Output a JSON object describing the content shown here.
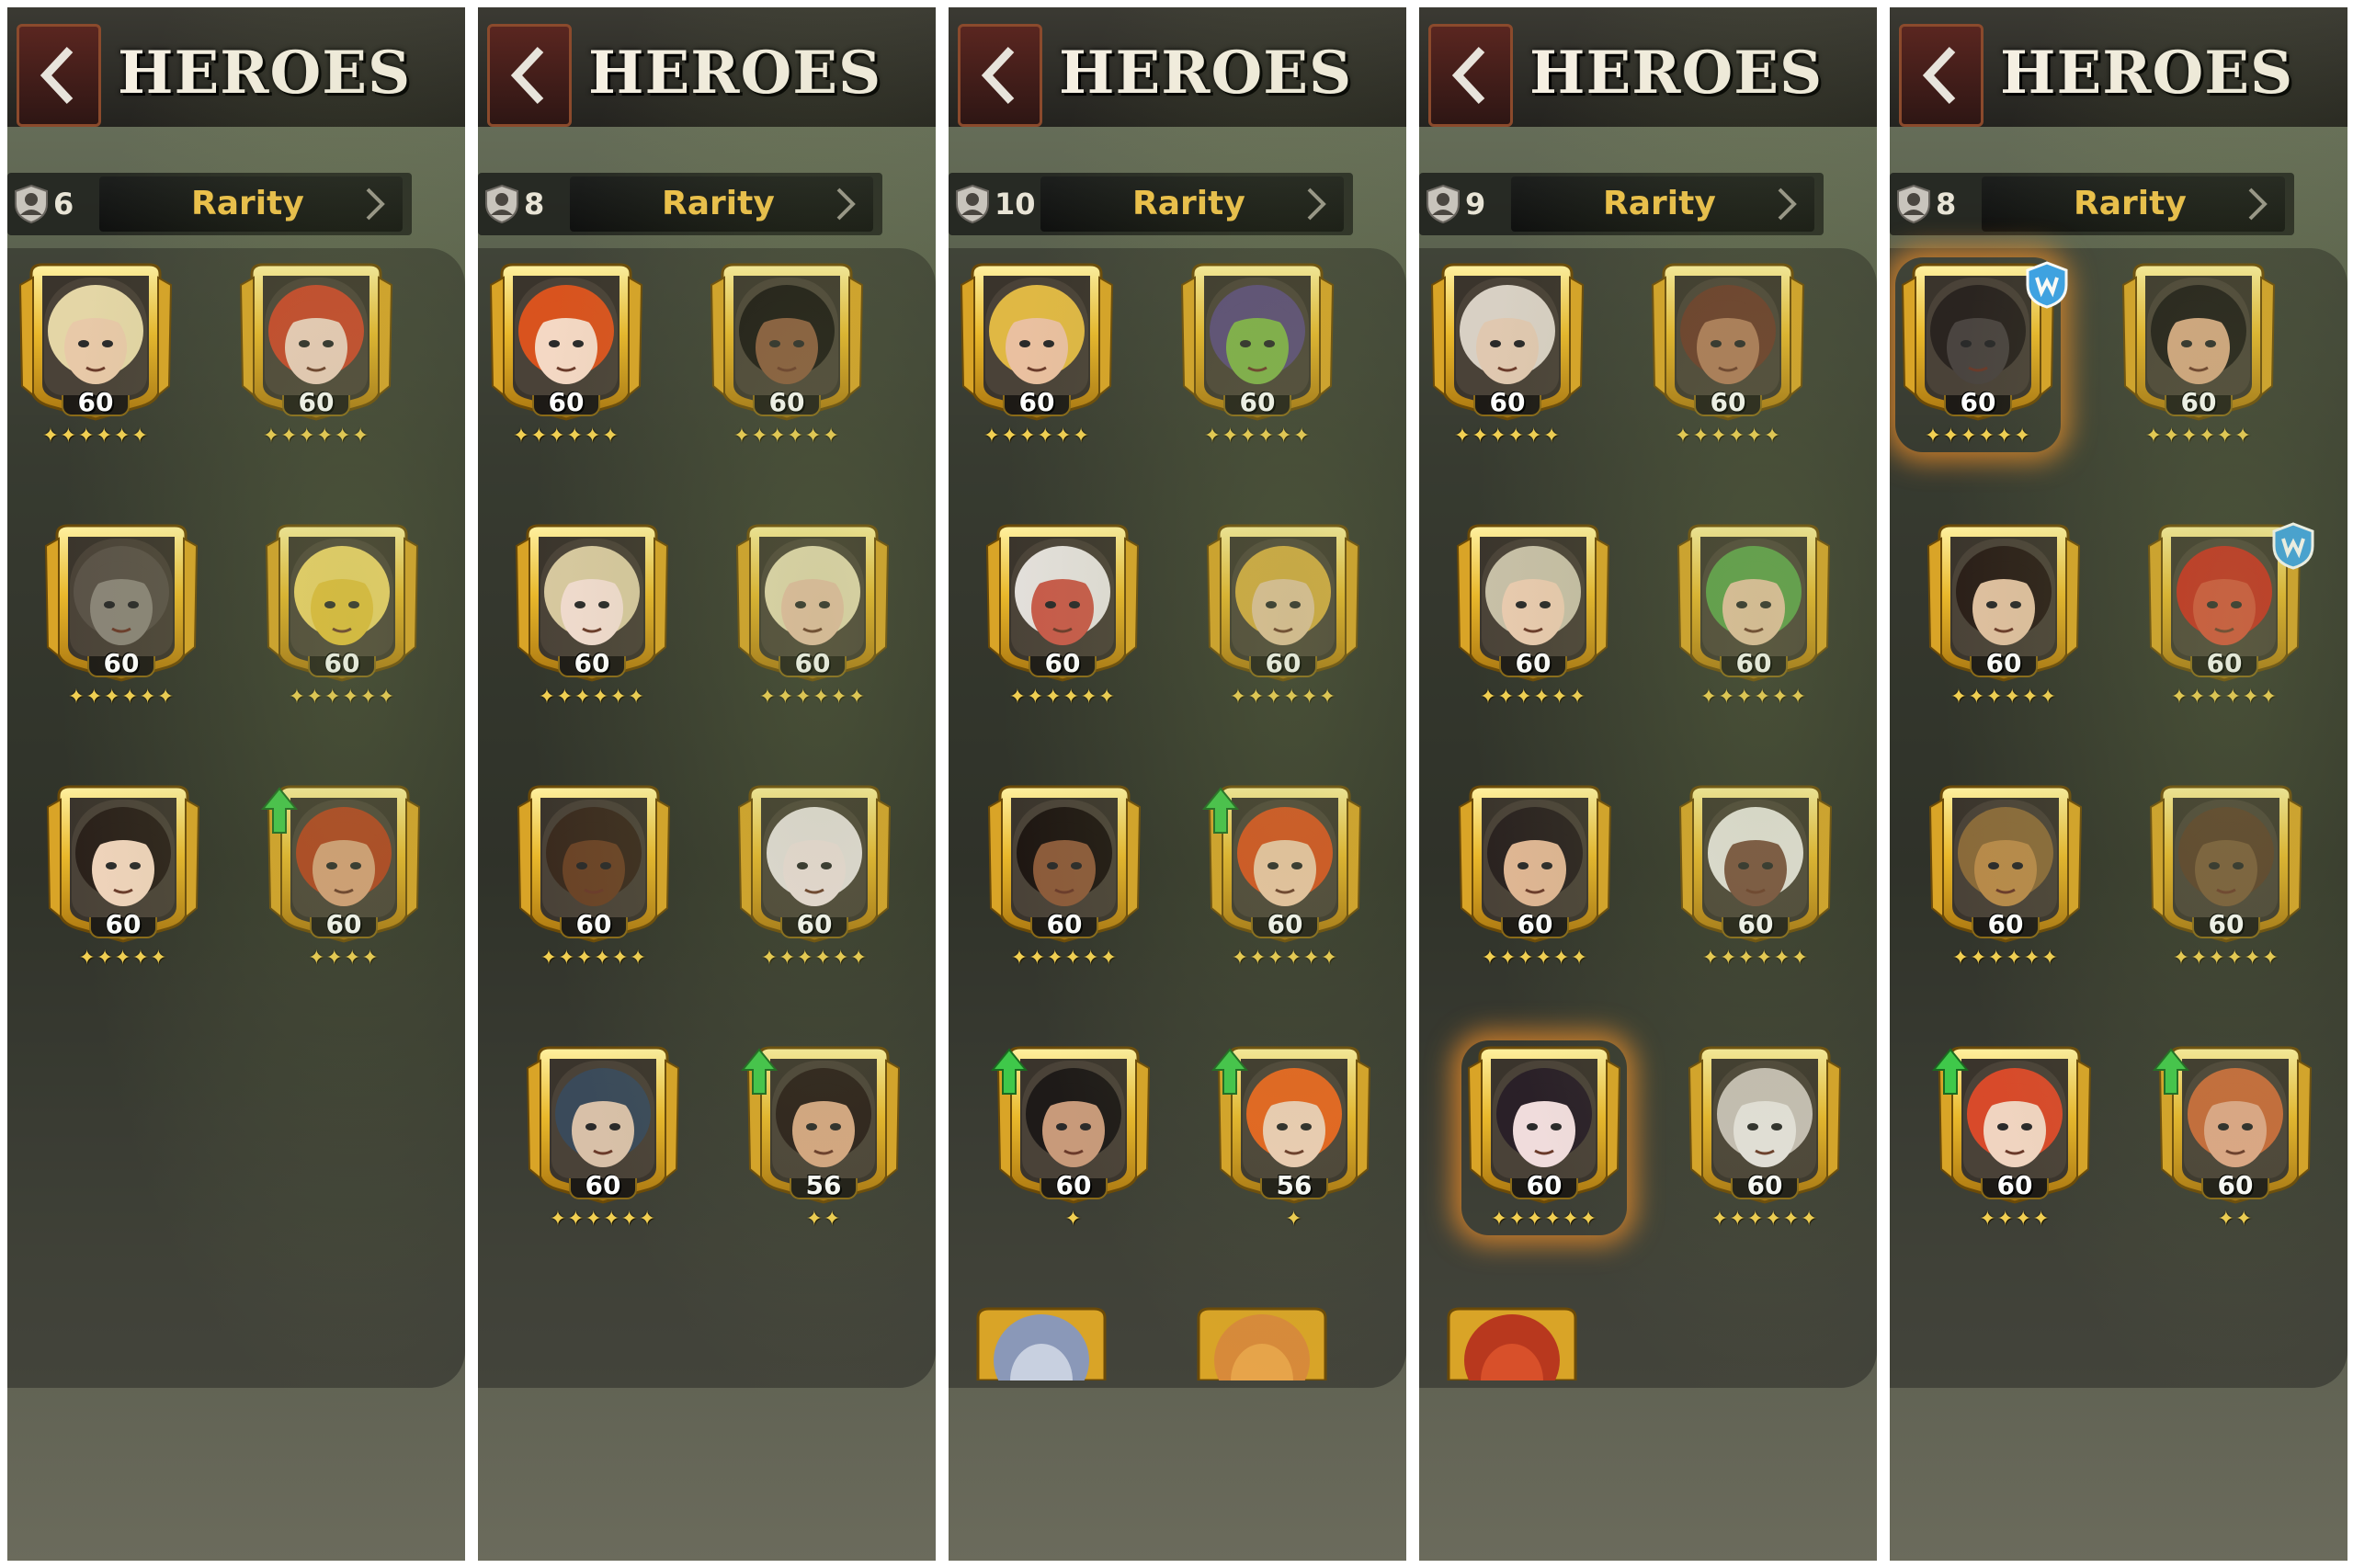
{
  "panels": [
    {
      "title": "HEROES",
      "hero_count": "6",
      "sort_label": "Rarity",
      "heroes": [
        {
          "icon": "blonde-elf-hero-portrait",
          "level": "60",
          "stars": "✦✦✦✦✦✦",
          "skin": "#e8c9a8",
          "hair": "#e4d6a6",
          "upgrade": false
        },
        {
          "icon": "fire-crowned-elf-hero-portrait",
          "level": "60",
          "stars": "✦✦✦✦✦✦",
          "skin": "#f0d0c0",
          "hair": "#c9452a",
          "upgrade": false
        },
        {
          "icon": "grey-beast-hero-portrait",
          "level": "60",
          "stars": "✦✦✦✦✦✦",
          "skin": "#8a8478",
          "hair": "#5a5248",
          "upgrade": false
        },
        {
          "icon": "golden-masked-hero-portrait",
          "level": "60",
          "stars": "✦✦✦✦✦✦",
          "skin": "#e8c23a",
          "hair": "#f2d66a",
          "upgrade": false
        },
        {
          "icon": "horned-dark-haired-girl-hero-portrait",
          "level": "60",
          "stars": "✦✦✦✦✦",
          "skin": "#f0d4bc",
          "hair": "#2a201a",
          "upgrade": false
        },
        {
          "icon": "goggled-red-beard-dwarf-hero-portrait",
          "level": "60",
          "stars": "✦✦✦✦",
          "skin": "#d9a07a",
          "hair": "#b2401e",
          "upgrade": true
        }
      ],
      "partial": []
    },
    {
      "title": "HEROES",
      "hero_count": "8",
      "sort_label": "Rarity",
      "heroes": [
        {
          "icon": "red-curly-haired-hero-portrait",
          "level": "60",
          "stars": "✦✦✦✦✦✦",
          "skin": "#f4d8c4",
          "hair": "#d9531e",
          "upgrade": false
        },
        {
          "icon": "dark-haired-elf-hero-portrait",
          "level": "60",
          "stars": "✦✦✦✦✦✦",
          "skin": "#8a5a3e",
          "hair": "#1a1614",
          "upgrade": false
        },
        {
          "icon": "antler-crowned-elf-hero-portrait",
          "level": "60",
          "stars": "✦✦✦✦✦✦",
          "skin": "#f2dcd0",
          "hair": "#d8c9a0",
          "upgrade": false
        },
        {
          "icon": "pale-long-eared-elf-hero-portrait",
          "level": "60",
          "stars": "✦✦✦✦✦✦",
          "skin": "#eac2a8",
          "hair": "#e8dcb4",
          "upgrade": false
        },
        {
          "icon": "armored-bull-hero-portrait",
          "level": "60",
          "stars": "✦✦✦✦✦✦",
          "skin": "#6a4226",
          "hair": "#3a2a1e",
          "upgrade": false
        },
        {
          "icon": "ram-horned-girl-hero-portrait",
          "level": "60",
          "stars": "✦✦✦✦✦✦",
          "skin": "#f0e0e0",
          "hair": "#e8e0e0",
          "upgrade": false
        },
        {
          "icon": "horned-bearded-sage-hero-portrait",
          "level": "60",
          "stars": "✦✦✦✦✦✦",
          "skin": "#d8c0a8",
          "hair": "#3a4a5a",
          "upgrade": false
        },
        {
          "icon": "dark-haired-satyr-hero-portrait",
          "level": "56",
          "stars": "✦✦",
          "skin": "#d8a884",
          "hair": "#2a1e1a",
          "upgrade": true
        }
      ],
      "partial": []
    },
    {
      "title": "HEROES",
      "hero_count": "10",
      "sort_label": "Rarity",
      "heroes": [
        {
          "icon": "gold-helmed-elf-hero-portrait",
          "level": "60",
          "stars": "✦✦✦✦✦✦",
          "skin": "#eac0a0",
          "hair": "#e0b844",
          "upgrade": false
        },
        {
          "icon": "green-goblin-hero-portrait",
          "level": "60",
          "stars": "✦✦✦✦✦✦",
          "skin": "#7fb24a",
          "hair": "#5a4a7a",
          "upgrade": false
        },
        {
          "icon": "white-haired-demon-hero-portrait",
          "level": "60",
          "stars": "✦✦✦✦✦✦",
          "skin": "#c85a4a",
          "hair": "#e4e0dc",
          "upgrade": false
        },
        {
          "icon": "winged-helm-hero-portrait",
          "level": "60",
          "stars": "✦✦✦✦✦✦",
          "skin": "#e6c49e",
          "hair": "#d8ac40",
          "upgrade": false
        },
        {
          "icon": "braided-dark-skinned-hero-portrait",
          "level": "60",
          "stars": "✦✦✦✦✦✦",
          "skin": "#8c5a3a",
          "hair": "#1e1612",
          "upgrade": false
        },
        {
          "icon": "orange-haired-gnome-hero-portrait",
          "level": "60",
          "stars": "✦✦✦✦✦✦",
          "skin": "#f0c8a8",
          "hair": "#d8501e",
          "upgrade": true
        },
        {
          "icon": "black-bearded-dwarf-hero-portrait",
          "level": "60",
          "stars": "✦",
          "skin": "#c89a7a",
          "hair": "#1e1a18",
          "upgrade": true
        },
        {
          "icon": "orange-braided-girl-hero-portrait",
          "level": "56",
          "stars": "✦",
          "skin": "#f0d0b8",
          "hair": "#e8641e",
          "upgrade": true
        }
      ],
      "partial": [
        {
          "icon": "partial-grey-haired-hero-portrait",
          "skin": "#c8d0e0",
          "hair": "#8a98b8"
        },
        {
          "icon": "partial-golden-hero-portrait",
          "skin": "#e8a44a",
          "hair": "#d88a3a"
        }
      ]
    },
    {
      "title": "HEROES",
      "hero_count": "9",
      "sort_label": "Rarity",
      "heroes": [
        {
          "icon": "white-helmed-knight-hero-portrait",
          "level": "60",
          "stars": "✦✦✦✦✦✦",
          "skin": "#e0c8b0",
          "hair": "#d8d0c4",
          "upgrade": false
        },
        {
          "icon": "brown-ogre-hero-portrait",
          "level": "60",
          "stars": "✦✦✦✦✦✦",
          "skin": "#b07a5a",
          "hair": "#6a3a2a",
          "upgrade": false
        },
        {
          "icon": "tiara-elf-hero-portrait",
          "level": "60",
          "stars": "✦✦✦✦✦✦",
          "skin": "#eacbb0",
          "hair": "#c8c0a8",
          "upgrade": false
        },
        {
          "icon": "leaf-crowned-elf-hero-portrait",
          "level": "60",
          "stars": "✦✦✦✦✦✦",
          "skin": "#e8c4a4",
          "hair": "#5aa04a",
          "upgrade": false
        },
        {
          "icon": "bald-bearded-man-hero-portrait",
          "level": "60",
          "stars": "✦✦✦✦✦✦",
          "skin": "#e0b694",
          "hair": "#2a2220",
          "upgrade": false
        },
        {
          "icon": "white-haired-dark-elf-hero-portrait",
          "level": "60",
          "stars": "✦✦✦✦✦✦",
          "skin": "#7a5040",
          "hair": "#e8e4e0",
          "upgrade": false
        },
        {
          "icon": "dark-haired-witch-hero-portrait",
          "level": "60",
          "stars": "✦✦✦✦✦✦",
          "skin": "#f0dcdc",
          "hair": "#2a2028",
          "upgrade": false,
          "selected": true
        },
        {
          "icon": "white-wolf-hero-portrait",
          "level": "60",
          "stars": "✦✦✦✦✦✦",
          "skin": "#e8e4e0",
          "hair": "#c8c0b8",
          "upgrade": false
        }
      ],
      "partial": [
        {
          "icon": "partial-red-hero-portrait",
          "skin": "#d8502a",
          "hair": "#b8381e"
        }
      ]
    },
    {
      "title": "HEROES",
      "hero_count": "8",
      "sort_label": "Rarity",
      "heroes": [
        {
          "icon": "horned-minotaur-hero-portrait",
          "level": "60",
          "stars": "✦✦✦✦✦✦",
          "skin": "#4a4440",
          "hair": "#2a2420",
          "upgrade": false,
          "badge": true,
          "selected": true
        },
        {
          "icon": "topknot-brute-hero-portrait",
          "level": "60",
          "stars": "✦✦✦✦✦✦",
          "skin": "#d8a884",
          "hair": "#1e1a18",
          "upgrade": false
        },
        {
          "icon": "tattooed-warrior-woman-hero-portrait",
          "level": "60",
          "stars": "✦✦✦✦✦✦",
          "skin": "#e0c0a0",
          "hair": "#2a1e18",
          "upgrade": false
        },
        {
          "icon": "red-haired-brute-hero-portrait",
          "level": "60",
          "stars": "✦✦✦✦✦✦",
          "skin": "#d8503a",
          "hair": "#c82a1e",
          "upgrade": false,
          "badge": true
        },
        {
          "icon": "tree-ent-hero-portrait",
          "level": "60",
          "stars": "✦✦✦✦✦✦",
          "skin": "#b88a4a",
          "hair": "#8a6a3a",
          "upgrade": false
        },
        {
          "icon": "wooden-totem-hero-portrait",
          "level": "60",
          "stars": "✦✦✦✦✦✦",
          "skin": "#7a5a3a",
          "hair": "#5a3e2a",
          "upgrade": false
        },
        {
          "icon": "red-braided-girl-hero-portrait",
          "level": "60",
          "stars": "✦✦✦✦",
          "skin": "#f0d4c0",
          "hair": "#d84a2a",
          "upgrade": true
        },
        {
          "icon": "bearded-dwarf-hero-portrait",
          "level": "60",
          "stars": "✦✦",
          "skin": "#e0a888",
          "hair": "#c86a3a",
          "upgrade": true
        }
      ],
      "partial": []
    }
  ]
}
